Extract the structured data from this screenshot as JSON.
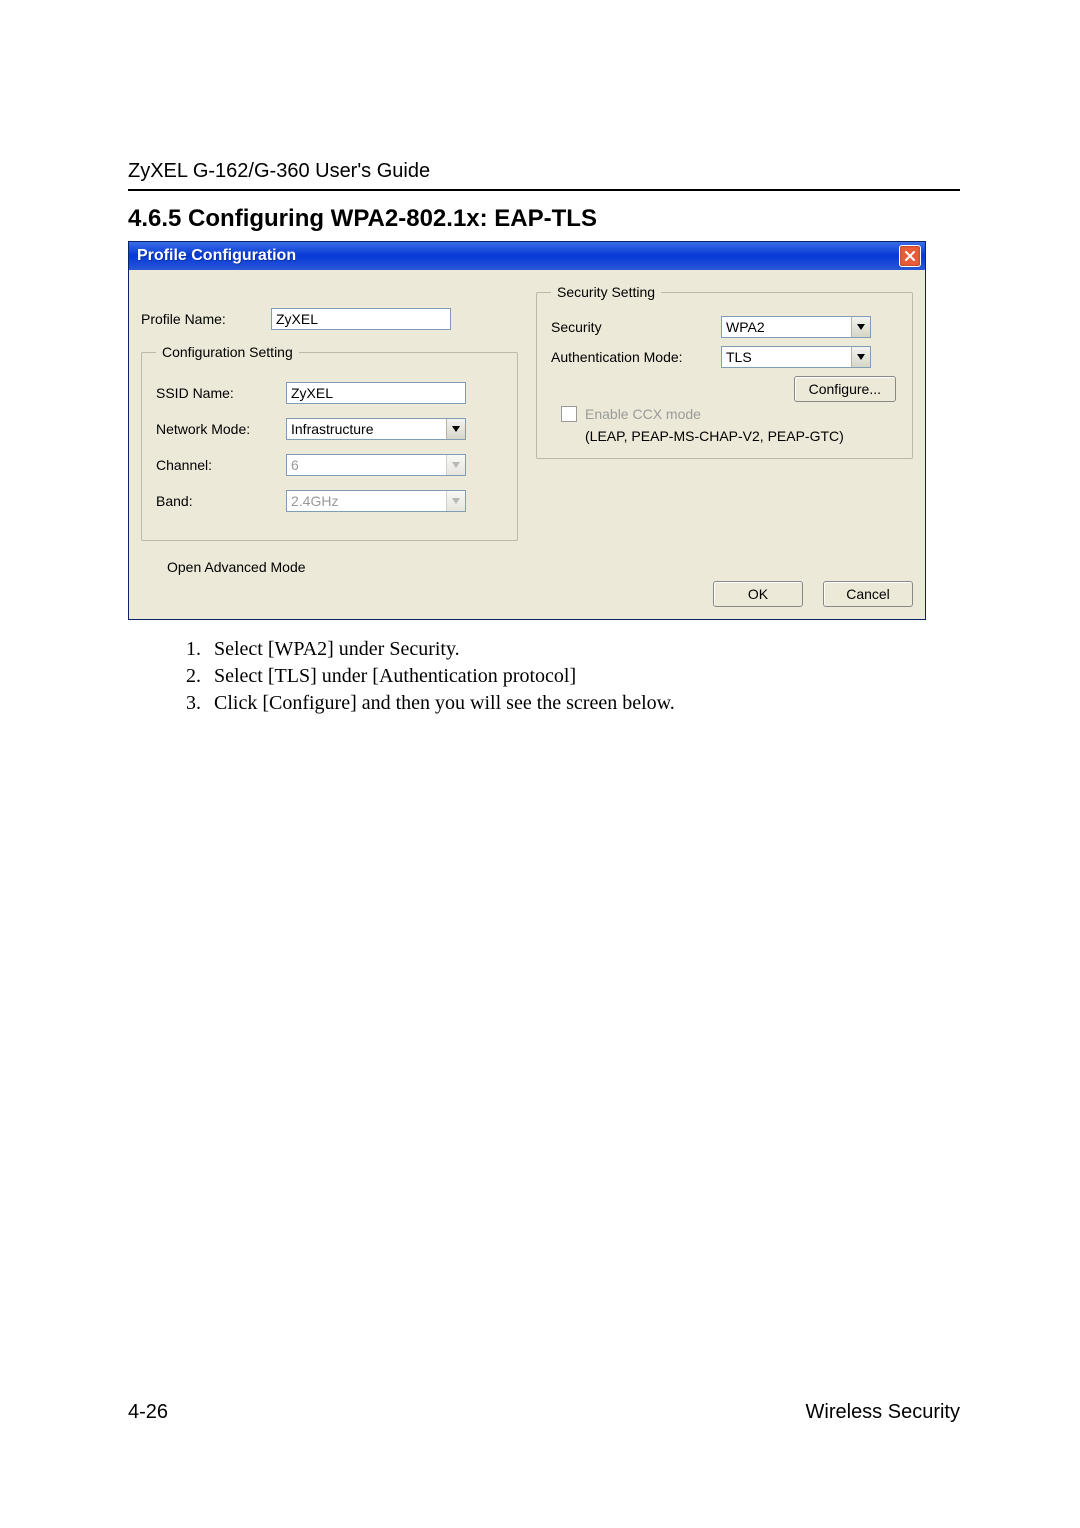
{
  "doc": {
    "header": "ZyXEL G-162/G-360 User's Guide",
    "section_heading": "4.6.5  Configuring WPA2-802.1x: EAP-TLS",
    "page_number": "4-26",
    "footer_right": "Wireless Security"
  },
  "window": {
    "title": "Profile Configuration",
    "profile_name_label": "Profile Name:",
    "profile_name_value": "ZyXEL",
    "config_legend": "Configuration Setting",
    "ssid_label": "SSID Name:",
    "ssid_value": "ZyXEL",
    "network_mode_label": "Network Mode:",
    "network_mode_value": "Infrastructure",
    "channel_label": "Channel:",
    "channel_value": "6",
    "band_label": "Band:",
    "band_value": "2.4GHz",
    "open_advanced": "Open Advanced Mode",
    "security_legend": "Security Setting",
    "security_label": "Security",
    "security_value": "WPA2",
    "auth_label": "Authentication Mode:",
    "auth_value": "TLS",
    "configure_btn": "Configure...",
    "ccx_label": "Enable CCX mode",
    "ccx_hint": "(LEAP, PEAP-MS-CHAP-V2, PEAP-GTC)",
    "ok": "OK",
    "cancel": "Cancel"
  },
  "steps": {
    "s1": "Select [WPA2] under Security.",
    "s2": "Select [TLS] under [Authentication protocol]",
    "s3": "Click [Configure] and then you will see the screen below."
  }
}
